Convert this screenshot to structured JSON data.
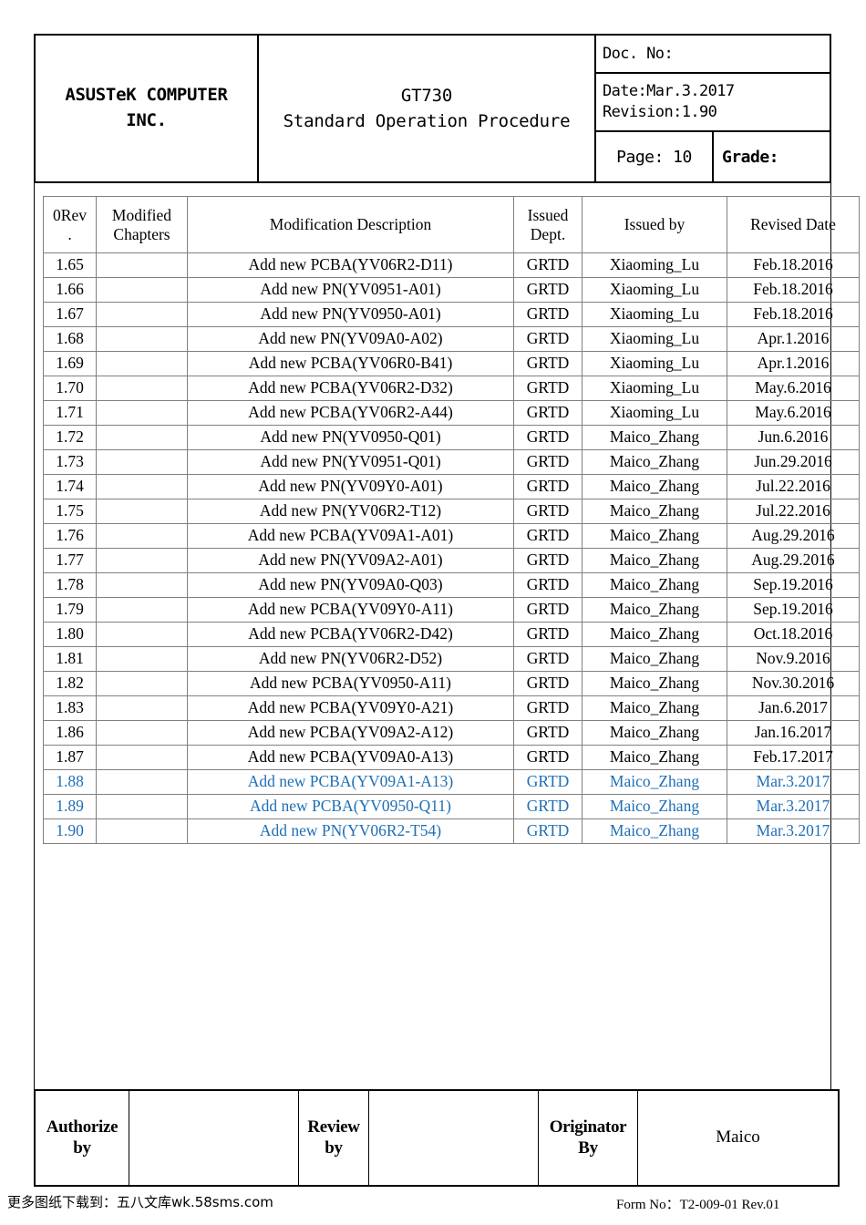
{
  "header": {
    "company_line1": "ASUSTeK COMPUTER",
    "company_line2": "INC.",
    "title_line1": "GT730",
    "title_line2": "Standard Operation Procedure",
    "doc_no_label": "Doc. No:",
    "date_label": "Date:Mar.3.2017",
    "revision_label": "Revision:1.90",
    "page_label": "Page: 10",
    "grade_label": "Grade:"
  },
  "revision_table": {
    "columns": [
      "0Rev.",
      "Modified Chapters",
      "Modification Description",
      "Issued Dept.",
      "Issued by",
      "Revised Date"
    ],
    "column_parts": {
      "rev_line1": "0Rev",
      "rev_line2": ".",
      "chapters_line1": "Modified",
      "chapters_line2": "Chapters",
      "description": "Modification Description",
      "dept_line1": "Issued",
      "dept_line2": "Dept.",
      "issued_by": "Issued by",
      "revised_date": "Revised Date"
    },
    "highlight_color": "#1F6FB5",
    "rows": [
      {
        "rev": "1.65",
        "chapters": "",
        "description": "Add new PCBA(YV06R2-D11)",
        "dept": "GRTD",
        "issued_by": "Xiaoming_Lu",
        "date": "Feb.18.2016",
        "highlighted": false
      },
      {
        "rev": "1.66",
        "chapters": "",
        "description": "Add new PN(YV0951-A01)",
        "dept": "GRTD",
        "issued_by": "Xiaoming_Lu",
        "date": "Feb.18.2016",
        "highlighted": false
      },
      {
        "rev": "1.67",
        "chapters": "",
        "description": "Add new PN(YV0950-A01)",
        "dept": "GRTD",
        "issued_by": "Xiaoming_Lu",
        "date": "Feb.18.2016",
        "highlighted": false
      },
      {
        "rev": "1.68",
        "chapters": "",
        "description": "Add new PN(YV09A0-A02)",
        "dept": "GRTD",
        "issued_by": "Xiaoming_Lu",
        "date": "Apr.1.2016",
        "highlighted": false
      },
      {
        "rev": "1.69",
        "chapters": "",
        "description": "Add new PCBA(YV06R0-B41)",
        "dept": "GRTD",
        "issued_by": "Xiaoming_Lu",
        "date": "Apr.1.2016",
        "highlighted": false
      },
      {
        "rev": "1.70",
        "chapters": "",
        "description": "Add new PCBA(YV06R2-D32)",
        "dept": "GRTD",
        "issued_by": "Xiaoming_Lu",
        "date": "May.6.2016",
        "highlighted": false
      },
      {
        "rev": "1.71",
        "chapters": "",
        "description": "Add new PCBA(YV06R2-A44)",
        "dept": "GRTD",
        "issued_by": "Xiaoming_Lu",
        "date": "May.6.2016",
        "highlighted": false
      },
      {
        "rev": "1.72",
        "chapters": "",
        "description": "Add new PN(YV0950-Q01)",
        "dept": "GRTD",
        "issued_by": "Maico_Zhang",
        "date": "Jun.6.2016",
        "highlighted": false
      },
      {
        "rev": "1.73",
        "chapters": "",
        "description": "Add new PN(YV0951-Q01)",
        "dept": "GRTD",
        "issued_by": "Maico_Zhang",
        "date": "Jun.29.2016",
        "highlighted": false
      },
      {
        "rev": "1.74",
        "chapters": "",
        "description": "Add new PN(YV09Y0-A01)",
        "dept": "GRTD",
        "issued_by": "Maico_Zhang",
        "date": "Jul.22.2016",
        "highlighted": false
      },
      {
        "rev": "1.75",
        "chapters": "",
        "description": "Add new PN(YV06R2-T12)",
        "dept": "GRTD",
        "issued_by": "Maico_Zhang",
        "date": "Jul.22.2016",
        "highlighted": false
      },
      {
        "rev": "1.76",
        "chapters": "",
        "description": "Add new PCBA(YV09A1-A01)",
        "dept": "GRTD",
        "issued_by": "Maico_Zhang",
        "date": "Aug.29.2016",
        "highlighted": false
      },
      {
        "rev": "1.77",
        "chapters": "",
        "description": "Add new PN(YV09A2-A01)",
        "dept": "GRTD",
        "issued_by": "Maico_Zhang",
        "date": "Aug.29.2016",
        "highlighted": false
      },
      {
        "rev": "1.78",
        "chapters": "",
        "description": "Add new PN(YV09A0-Q03)",
        "dept": "GRTD",
        "issued_by": "Maico_Zhang",
        "date": "Sep.19.2016",
        "highlighted": false
      },
      {
        "rev": "1.79",
        "chapters": "",
        "description": "Add new PCBA(YV09Y0-A11)",
        "dept": "GRTD",
        "issued_by": "Maico_Zhang",
        "date": "Sep.19.2016",
        "highlighted": false
      },
      {
        "rev": "1.80",
        "chapters": "",
        "description": "Add new PCBA(YV06R2-D42)",
        "dept": "GRTD",
        "issued_by": "Maico_Zhang",
        "date": "Oct.18.2016",
        "highlighted": false
      },
      {
        "rev": "1.81",
        "chapters": "",
        "description": "Add new PN(YV06R2-D52)",
        "dept": "GRTD",
        "issued_by": "Maico_Zhang",
        "date": "Nov.9.2016",
        "highlighted": false
      },
      {
        "rev": "1.82",
        "chapters": "",
        "description": "Add new PCBA(YV0950-A11)",
        "dept": "GRTD",
        "issued_by": "Maico_Zhang",
        "date": "Nov.30.2016",
        "highlighted": false
      },
      {
        "rev": "1.83",
        "chapters": "",
        "description": "Add new PCBA(YV09Y0-A21)",
        "dept": "GRTD",
        "issued_by": "Maico_Zhang",
        "date": "Jan.6.2017",
        "highlighted": false
      },
      {
        "rev": "1.86",
        "chapters": "",
        "description": "Add new PCBA(YV09A2-A12)",
        "dept": "GRTD",
        "issued_by": "Maico_Zhang",
        "date": "Jan.16.2017",
        "highlighted": false
      },
      {
        "rev": "1.87",
        "chapters": "",
        "description": "Add new PCBA(YV09A0-A13)",
        "dept": "GRTD",
        "issued_by": "Maico_Zhang",
        "date": "Feb.17.2017",
        "highlighted": false
      },
      {
        "rev": "1.88",
        "chapters": "",
        "description": "Add new PCBA(YV09A1-A13)",
        "dept": "GRTD",
        "issued_by": "Maico_Zhang",
        "date": "Mar.3.2017",
        "highlighted": true
      },
      {
        "rev": "1.89",
        "chapters": "",
        "description": "Add new PCBA(YV0950-Q11)",
        "dept": "GRTD",
        "issued_by": "Maico_Zhang",
        "date": "Mar.3.2017",
        "highlighted": true
      },
      {
        "rev": "1.90",
        "chapters": "",
        "description": "Add new PN(YV06R2-T54)",
        "dept": "GRTD",
        "issued_by": "Maico_Zhang",
        "date": "Mar.3.2017",
        "highlighted": true
      }
    ]
  },
  "signature": {
    "authorize_line1": "Authorize",
    "authorize_line2": "by",
    "authorize_value": "",
    "review_line1": "Review",
    "review_line2": "by",
    "review_value": "",
    "originator_line1": "Originator",
    "originator_line2": "By",
    "originator_value": "Maico"
  },
  "footer": {
    "watermark": "更多图纸下载到：五八文库wk.58sms.com",
    "form_no": "Form No：T2-009-01  Rev.01"
  }
}
